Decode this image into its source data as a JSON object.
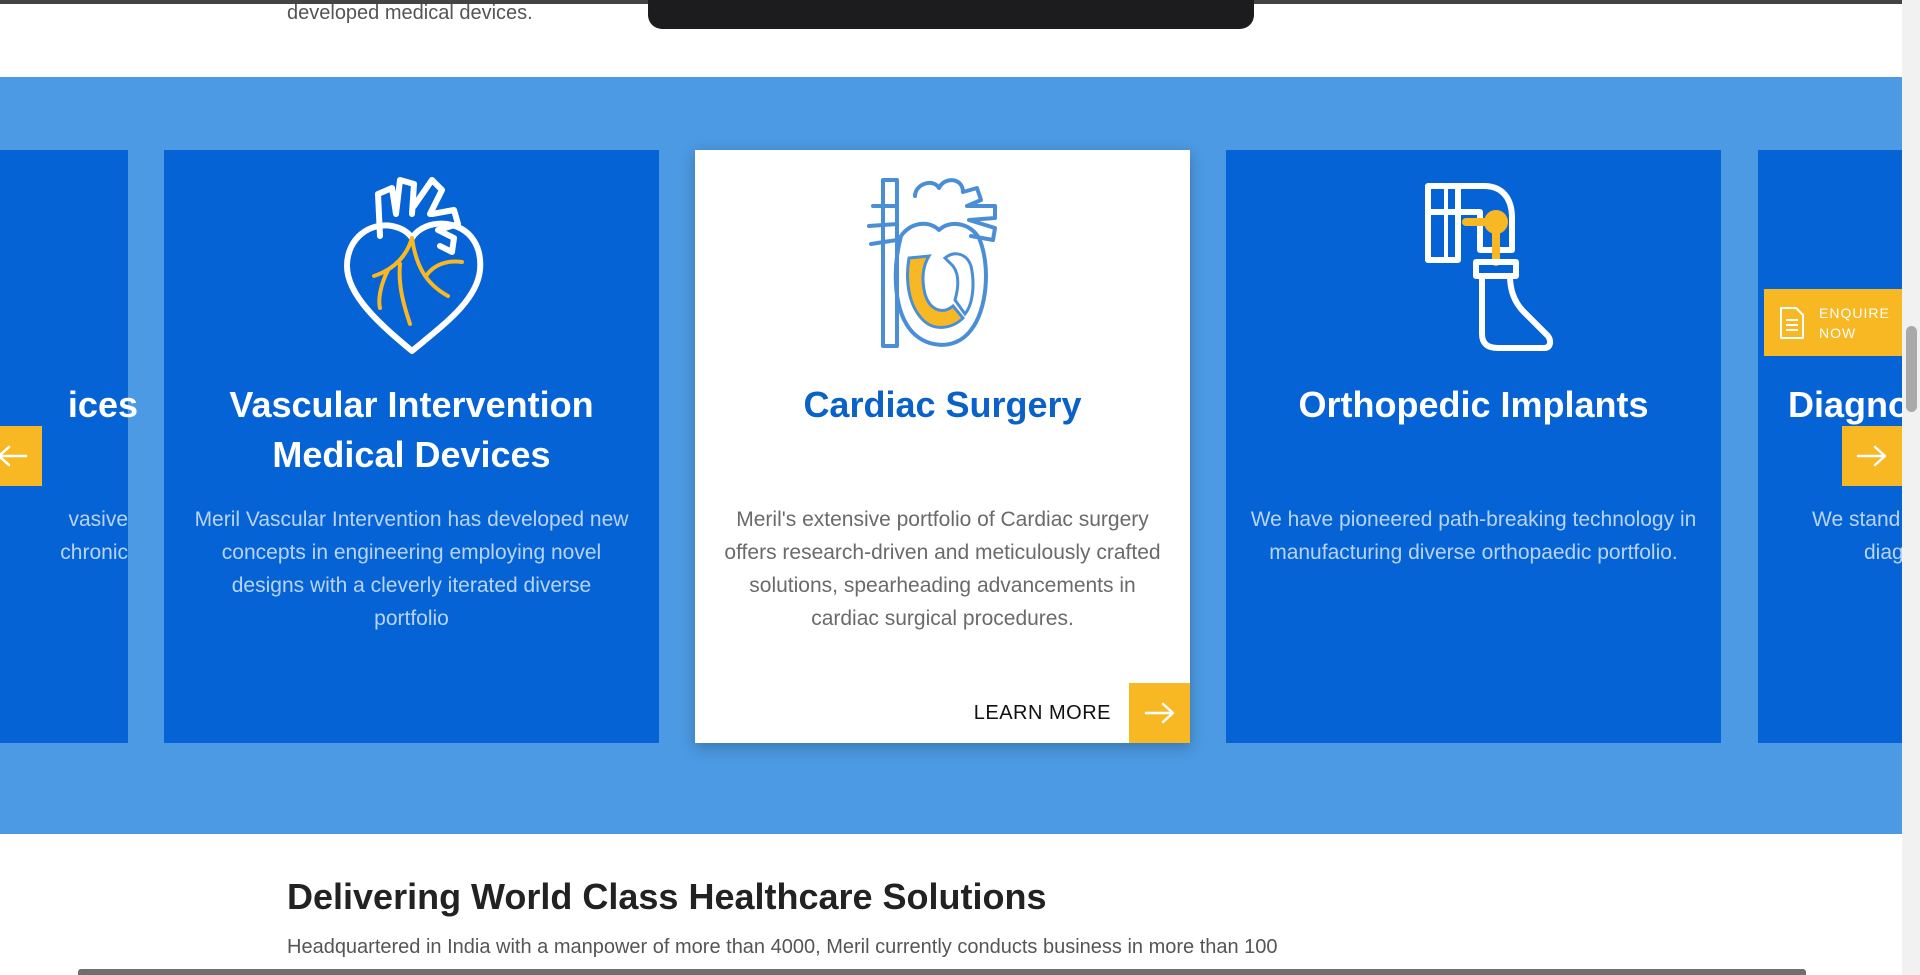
{
  "intro": {
    "tail_text": "developed medical devices."
  },
  "cards": [
    {
      "title": "ices",
      "desc_lines": [
        "vasive",
        "chronic"
      ]
    },
    {
      "title_lines": [
        "Vascular Intervention",
        "Medical Devices"
      ],
      "desc_lines": [
        "Meril Vascular Intervention has developed new",
        "concepts in engineering employing novel",
        "designs with a cleverly iterated diverse",
        "portfolio"
      ],
      "icon": "heart-icon"
    },
    {
      "title": "Cardiac Surgery",
      "desc_lines": [
        "Meril's extensive portfolio of Cardiac surgery",
        "offers research-driven and meticulously crafted",
        "solutions, spearheading advancements in",
        "cardiac surgical procedures."
      ],
      "icon": "heart-anatomy-icon",
      "cta_label": "LEARN MORE"
    },
    {
      "title": "Orthopedic Implants",
      "desc_lines": [
        "We have pioneered path-breaking technology in",
        "manufacturing diverse orthopaedic portfolio."
      ],
      "icon": "leg-brace-icon"
    },
    {
      "title": "Diagno",
      "desc_lines": [
        "We stand",
        "diag"
      ]
    }
  ],
  "enquire": {
    "label_line1": "ENQUIRE",
    "label_line2": "NOW",
    "icon": "document-icon"
  },
  "section": {
    "heading": "Delivering World Class Healthcare Solutions",
    "body": "Headquartered in India with a manpower of more than 4000, Meril currently conducts business in more than 100"
  },
  "colors": {
    "band": "#4c9ae3",
    "card": "#0563d6",
    "accent": "#f7b824",
    "title_blue": "#0a62c8"
  }
}
